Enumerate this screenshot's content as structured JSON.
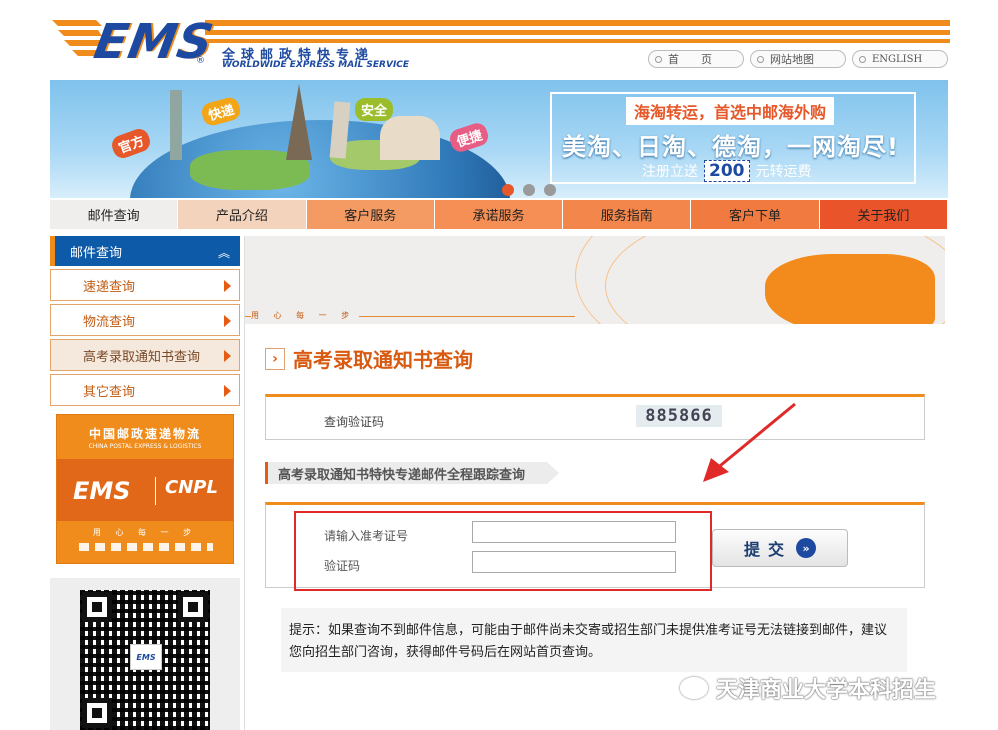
{
  "header": {
    "logo_text": "EMS",
    "logo_reg": "®",
    "logo_cn": "全球邮政特快专递",
    "logo_en": "WORLDWIDE EXPRESS MAIL SERVICE",
    "top_links": [
      "首　　页",
      "网站地图",
      "ENGLISH"
    ]
  },
  "banner": {
    "tags": [
      "官方",
      "快递",
      "安全",
      "便捷"
    ],
    "promo_top": "海淘转运，首选中邮海外购",
    "promo_mid": "美淘、日淘、德淘，一网淘尽!",
    "promo_bot_pre": "注册立送",
    "promo_bot_num": "200",
    "promo_bot_post": "元转运费",
    "active_slide": 1,
    "slides": 3
  },
  "nav": {
    "items": [
      {
        "label": "邮件查询",
        "bg": "#f0eeec"
      },
      {
        "label": "产品介绍",
        "bg": "#f4d3bd"
      },
      {
        "label": "客户服务",
        "bg": "#f49a63"
      },
      {
        "label": "承诺服务",
        "bg": "#f58f55"
      },
      {
        "label": "服务指南",
        "bg": "#f3864a"
      },
      {
        "label": "客户下单",
        "bg": "#f07a3f"
      },
      {
        "label": "关于我们",
        "bg": "#e9542a"
      }
    ]
  },
  "sidebar": {
    "head": "邮件查询",
    "items": [
      {
        "label": "速递查询",
        "selected": false
      },
      {
        "label": "物流查询",
        "selected": false
      },
      {
        "label": "高考录取通知书查询",
        "selected": true
      },
      {
        "label": "其它查询",
        "selected": false
      }
    ],
    "ad": {
      "cn": "中国邮政速递物流",
      "en": "CHINA POSTAL EXPRESS & LOGISTICS",
      "ems": "EMS",
      "cnpl": "CNPL",
      "motto": "用 心 每 一 步"
    },
    "qr_logo": "EMS"
  },
  "main": {
    "banner_text": "用 心 每 一 步",
    "title": "高考录取通知书查询",
    "captcha_label": "查询验证码",
    "captcha_value": "885866",
    "sub_heading": "高考录取通知书特快专递邮件全程跟踪查询",
    "form": {
      "exam_label": "请输入准考证号",
      "exam_value": "",
      "code_label": "验证码",
      "code_value": "",
      "submit_label": "提交"
    },
    "tip": "提示：如果查询不到邮件信息，可能由于邮件尚未交寄或招生部门未提供准考证号无法链接到邮件，建议您向招生部门咨询，获得邮件号码后在网站首页查询。"
  },
  "watermark": "天津商业大学本科招生"
}
